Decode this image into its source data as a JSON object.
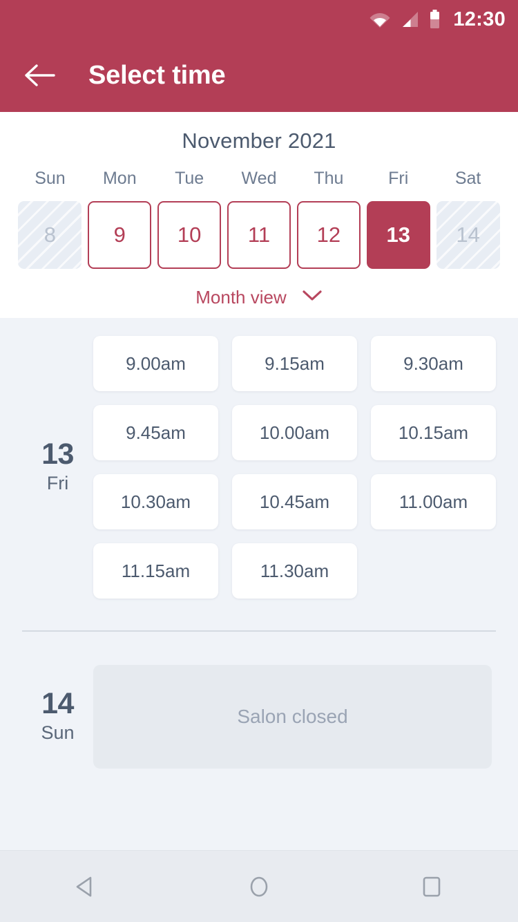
{
  "status_bar": {
    "time": "12:30",
    "icons": [
      "wifi-icon",
      "cellular-signal-icon",
      "battery-icon"
    ]
  },
  "app_bar": {
    "title": "Select time",
    "back_icon": "arrow-left-icon"
  },
  "calendar": {
    "month_label": "November 2021",
    "day_of_week_headers": [
      "Sun",
      "Mon",
      "Tue",
      "Wed",
      "Thu",
      "Fri",
      "Sat"
    ],
    "days": [
      {
        "number": "8",
        "state": "disabled"
      },
      {
        "number": "9",
        "state": "available"
      },
      {
        "number": "10",
        "state": "available"
      },
      {
        "number": "11",
        "state": "available"
      },
      {
        "number": "12",
        "state": "available"
      },
      {
        "number": "13",
        "state": "selected"
      },
      {
        "number": "14",
        "state": "disabled"
      }
    ],
    "month_view_label": "Month view",
    "month_view_icon": "chevron-down-icon"
  },
  "schedule": {
    "groups": [
      {
        "day_number": "13",
        "day_of_week": "Fri",
        "slots": [
          "9.00am",
          "9.15am",
          "9.30am",
          "9.45am",
          "10.00am",
          "10.15am",
          "10.30am",
          "10.45am",
          "11.00am",
          "11.15am",
          "11.30am"
        ],
        "closed_message": null
      },
      {
        "day_number": "14",
        "day_of_week": "Sun",
        "slots": [],
        "closed_message": "Salon closed"
      }
    ]
  },
  "nav_bar": {
    "buttons": [
      {
        "icon": "back-triangle-icon"
      },
      {
        "icon": "home-circle-icon"
      },
      {
        "icon": "recents-square-icon"
      }
    ]
  },
  "colors": {
    "brand_crimson": "#b33e56",
    "page_background": "#f0f3f8",
    "panel_white": "#ffffff",
    "text_slate": "#4c5a6e",
    "text_muted": "#9aa4b4",
    "disabled_cell": "#e8edf4",
    "closed_card": "#e6eaef",
    "nav_bar_background": "#e8ebf0"
  }
}
